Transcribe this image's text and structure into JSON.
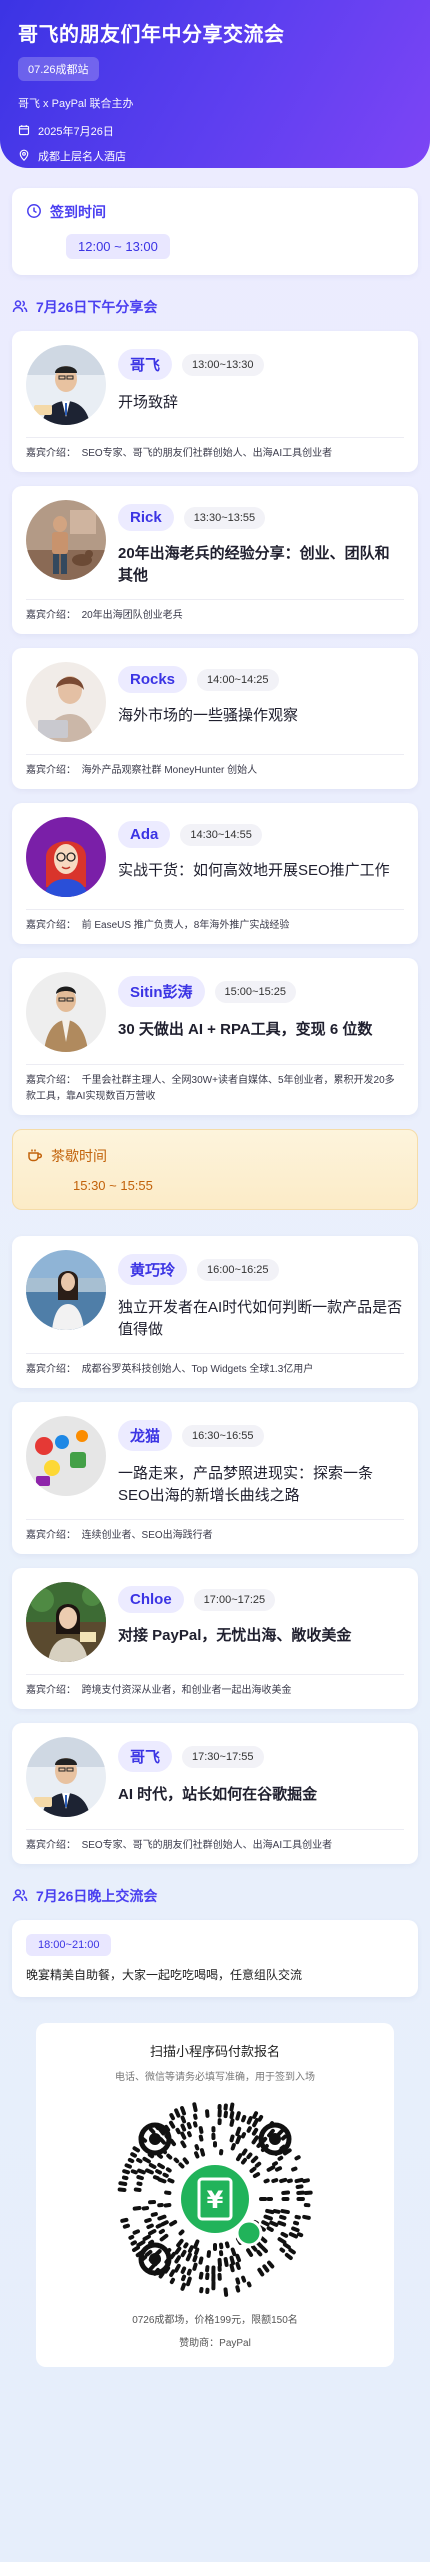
{
  "header": {
    "title": "哥飞的朋友们年中分享交流会",
    "tag": "07.26成都站",
    "sponsor": "哥飞 x PayPal 联合主办",
    "date": "2025年7月26日",
    "location": "成都上层名人酒店"
  },
  "signin": {
    "title": "签到时间",
    "time": "12:00 ~ 13:00"
  },
  "afternoon": {
    "title": "7月26日下午分享会",
    "bio_label": "嘉宾介绍：",
    "speakers": [
      {
        "name": "哥飞",
        "time": "13:00~13:30",
        "topic": "开场致辞",
        "bio": "SEO专家、哥飞的朋友们社群创始人、出海AI工具创业者",
        "avatar": "man-suit-glasses"
      },
      {
        "name": "Rick",
        "time": "13:30~13:55",
        "topic": "20年出海老兵的经验分享：创业、团队和其他",
        "bio": "20年出海团队创业老兵",
        "avatar": "man-with-dog"
      },
      {
        "name": "Rocks",
        "time": "14:00~14:25",
        "topic": "海外市场的一些骚操作观察",
        "bio": "海外产品观察社群 MoneyHunter 创始人",
        "avatar": "woman-laptop"
      },
      {
        "name": "Ada",
        "time": "14:30~14:55",
        "topic": "实战干货：如何高效地开展SEO推广工作",
        "bio": "前 EaseUS 推广负责人，8年海外推广实战经验",
        "avatar": "illustrated-woman"
      },
      {
        "name": "Sitin彭涛",
        "time": "15:00~15:25",
        "topic": "30 天做出 AI + RPA工具，变现 6 位数",
        "bio": "千里会社群主理人、全网30W+读者自媒体、5年创业者，累积开发20多款工具，靠AI实现数百万营收",
        "avatar": "man-jacket"
      }
    ]
  },
  "tea": {
    "title": "茶歇时间",
    "time": "15:30 ~ 15:55"
  },
  "afternoon2": {
    "speakers": [
      {
        "name": "黄巧玲",
        "time": "16:00~16:25",
        "topic": "独立开发者在AI时代如何判断一款产品是否值得做",
        "bio": "成都谷罗英科技创始人、Top Widgets 全球1.3亿用户",
        "avatar": "woman-sea"
      },
      {
        "name": "龙猫",
        "time": "16:30~16:55",
        "topic": "一路走来，产品梦照进现实：探索一条SEO出海的新增长曲线之路",
        "bio": "连续创业者、SEO出海践行者",
        "avatar": "colorful-toys"
      },
      {
        "name": "Chloe",
        "time": "17:00~17:25",
        "topic": "对接 PayPal，无忧出海、敞收美金",
        "bio": "跨境支付资深从业者，和创业者一起出海收美金",
        "avatar": "woman-plant"
      },
      {
        "name": "哥飞",
        "time": "17:30~17:55",
        "topic": "AI 时代，站长如何在谷歌掘金",
        "bio": "SEO专家、哥飞的朋友们社群创始人、出海AI工具创业者",
        "avatar": "man-suit-glasses"
      }
    ]
  },
  "evening": {
    "title": "7月26日晚上交流会",
    "time": "18:00~21:00",
    "desc": "晚宴精美自助餐，大家一起吃吃喝喝，任意组队交流"
  },
  "qr": {
    "title": "扫描小程序码付款报名",
    "subtitle": "电话、微信等请务必填写准确，用于签到入场",
    "price": "0726成都场，价格199元，限额150名",
    "sponsor": "赞助商：PayPal"
  },
  "colors": {
    "accent": "#4a3ff0",
    "hero_start": "#3b34e4",
    "hero_end": "#7d45f5",
    "tea": "#c2620a",
    "qr_green": "#21b35a"
  }
}
